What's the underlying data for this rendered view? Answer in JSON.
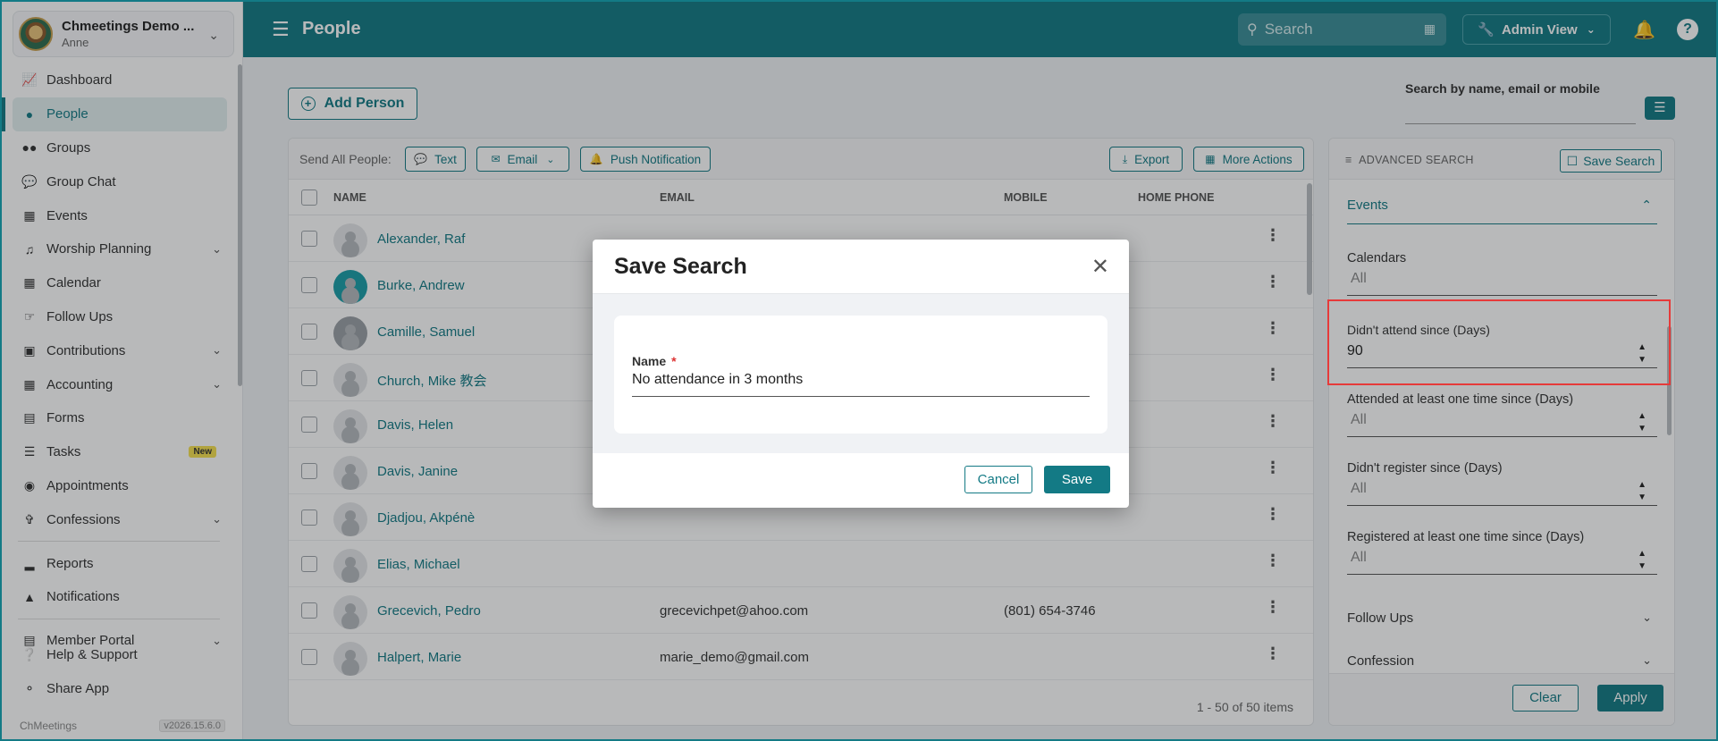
{
  "org": {
    "name": "Chmeetings Demo ...",
    "user": "Anne"
  },
  "sidebar": {
    "items": [
      {
        "label": "Dashboard",
        "icon": "chart-line-icon"
      },
      {
        "label": "People",
        "icon": "person-icon",
        "active": true
      },
      {
        "label": "Groups",
        "icon": "groups-icon"
      },
      {
        "label": "Group Chat",
        "icon": "chat-icon"
      },
      {
        "label": "Events",
        "icon": "calendar-icon"
      },
      {
        "label": "Worship Planning",
        "icon": "music-icon",
        "expandable": true
      },
      {
        "label": "Calendar",
        "icon": "calendar-grid-icon"
      },
      {
        "label": "Follow Ups",
        "icon": "handshake-icon"
      },
      {
        "label": "Contributions",
        "icon": "money-icon",
        "expandable": true
      },
      {
        "label": "Accounting",
        "icon": "grid-icon",
        "expandable": true
      },
      {
        "label": "Forms",
        "icon": "form-icon"
      },
      {
        "label": "Tasks",
        "icon": "tasks-icon",
        "badge": "New"
      },
      {
        "label": "Appointments",
        "icon": "appointment-icon"
      },
      {
        "label": "Confessions",
        "icon": "confession-icon",
        "expandable": true
      },
      {
        "label": "Reports",
        "icon": "reports-icon"
      },
      {
        "label": "Notifications",
        "icon": "bell-icon"
      },
      {
        "label": "Member Portal",
        "icon": "portal-icon",
        "expandable": true
      }
    ],
    "bottom": [
      {
        "label": "Help & Support",
        "icon": "help-icon"
      },
      {
        "label": "Share App",
        "icon": "share-icon"
      }
    ],
    "footer_brand": "ChMeetings",
    "version": "v2026.15.6.0"
  },
  "topbar": {
    "title": "People",
    "search_placeholder": "Search",
    "admin_view": "Admin View"
  },
  "main": {
    "add_person": "Add Person",
    "send_all_label": "Send All People:",
    "btn_text": "Text",
    "btn_email": "Email",
    "btn_push": "Push Notification",
    "btn_export": "Export",
    "btn_more": "More Actions",
    "columns": {
      "name": "NAME",
      "email": "EMAIL",
      "mobile": "MOBILE",
      "home_phone": "HOME PHONE"
    },
    "rows": [
      {
        "name": "Alexander, Raf",
        "email": "",
        "mobile": ""
      },
      {
        "name": "Burke, Andrew",
        "email": "",
        "mobile": ""
      },
      {
        "name": "Camille, Samuel",
        "email": "",
        "mobile": ""
      },
      {
        "name": "Church, Mike 教会",
        "email": "",
        "mobile": ""
      },
      {
        "name": "Davis, Helen",
        "email": "",
        "mobile": ""
      },
      {
        "name": "Davis, Janine",
        "email": "",
        "mobile": ""
      },
      {
        "name": "Djadjou, Akpénè",
        "email": "",
        "mobile": ""
      },
      {
        "name": "Elias, Michael",
        "email": "",
        "mobile": ""
      },
      {
        "name": "Grecevich, Pedro",
        "email": "grecevichpet@ahoo.com",
        "mobile": "(801) 654-3746"
      },
      {
        "name": "Halpert, Marie",
        "email": "marie_demo@gmail.com",
        "mobile": ""
      }
    ],
    "pager": "1 - 50 of 50 items"
  },
  "search_by": {
    "label": "Search by name, email or mobile"
  },
  "advanced": {
    "title": "ADVANCED SEARCH",
    "save_search": "Save Search",
    "section": "Events",
    "calendars_label": "Calendars",
    "calendars_value": "All",
    "didnt_attend_label": "Didn't attend since (Days)",
    "didnt_attend_value": "90",
    "attended_label": "Attended at least one time since (Days)",
    "attended_value": "All",
    "didnt_register_label": "Didn't register since (Days)",
    "didnt_register_value": "All",
    "registered_label": "Registered at least one time since (Days)",
    "registered_value": "All",
    "follow_ups": "Follow Ups",
    "confession": "Confession",
    "clear": "Clear",
    "apply": "Apply"
  },
  "modal": {
    "title": "Save Search",
    "name_label": "Name",
    "required_mark": "*",
    "name_value": "No attendance in 3 months",
    "cancel": "Cancel",
    "save": "Save"
  },
  "colors": {
    "primary": "#137a85",
    "highlight": "#e63a3a"
  }
}
